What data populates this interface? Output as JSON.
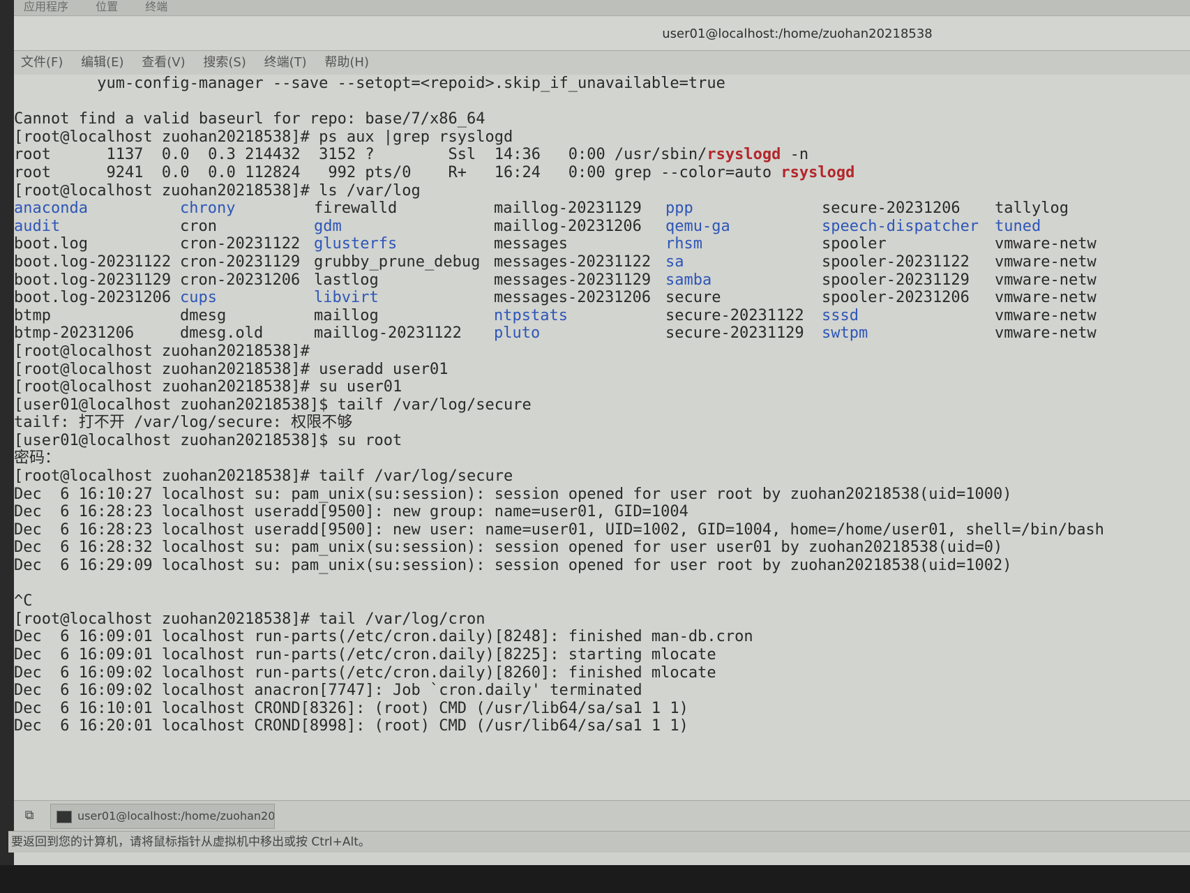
{
  "topbar": {
    "applications": "应用程序",
    "places": "位置",
    "terminal": "终端"
  },
  "window": {
    "title": "user01@localhost:/home/zuohan20218538"
  },
  "menu": [
    "文件(F)",
    "编辑(E)",
    "查看(V)",
    "搜索(S)",
    "终端(T)",
    "帮助(H)"
  ],
  "terminal": {
    "lines_before": [
      "         yum-config-manager --save --setopt=<repoid>.skip_if_unavailable=true",
      "",
      "Cannot find a valid baseurl for repo: base/7/x86_64",
      "[root@localhost zuohan20218538]# ps aux |grep rsyslogd"
    ],
    "ps_rows": [
      {
        "pre": "root      1137  0.0  0.3 214432  3152 ?        Ssl  14:36   0:00 /usr/sbin/",
        "hl": "rsyslogd",
        "post": " -n"
      },
      {
        "pre": "root      9241  0.0  0.0 112824   992 pts/0    R+   16:24   0:00 grep --color=auto ",
        "hl": "rsyslogd",
        "post": ""
      }
    ],
    "ls_command": "[root@localhost zuohan20218538]# ls /var/log",
    "ls_rows": [
      [
        {
          "t": "anaconda",
          "d": true
        },
        {
          "t": "chrony",
          "d": true
        },
        {
          "t": "firewalld",
          "d": false
        },
        {
          "t": "maillog-20231129",
          "d": false
        },
        {
          "t": "ppp",
          "d": true
        },
        {
          "t": "secure-20231206",
          "d": false
        },
        {
          "t": "tallylog",
          "d": false
        }
      ],
      [
        {
          "t": "audit",
          "d": true
        },
        {
          "t": "cron",
          "d": false
        },
        {
          "t": "gdm",
          "d": true
        },
        {
          "t": "maillog-20231206",
          "d": false
        },
        {
          "t": "qemu-ga",
          "d": true
        },
        {
          "t": "speech-dispatcher",
          "d": true
        },
        {
          "t": "tuned",
          "d": true
        }
      ],
      [
        {
          "t": "boot.log",
          "d": false
        },
        {
          "t": "cron-20231122",
          "d": false
        },
        {
          "t": "glusterfs",
          "d": true
        },
        {
          "t": "messages",
          "d": false
        },
        {
          "t": "rhsm",
          "d": true
        },
        {
          "t": "spooler",
          "d": false
        },
        {
          "t": "vmware-netw",
          "d": false
        }
      ],
      [
        {
          "t": "boot.log-20231122",
          "d": false
        },
        {
          "t": "cron-20231129",
          "d": false
        },
        {
          "t": "grubby_prune_debug",
          "d": false
        },
        {
          "t": "messages-20231122",
          "d": false
        },
        {
          "t": "sa",
          "d": true
        },
        {
          "t": "spooler-20231122",
          "d": false
        },
        {
          "t": "vmware-netw",
          "d": false
        }
      ],
      [
        {
          "t": "boot.log-20231129",
          "d": false
        },
        {
          "t": "cron-20231206",
          "d": false
        },
        {
          "t": "lastlog",
          "d": false
        },
        {
          "t": "messages-20231129",
          "d": false
        },
        {
          "t": "samba",
          "d": true
        },
        {
          "t": "spooler-20231129",
          "d": false
        },
        {
          "t": "vmware-netw",
          "d": false
        }
      ],
      [
        {
          "t": "boot.log-20231206",
          "d": false
        },
        {
          "t": "cups",
          "d": true
        },
        {
          "t": "libvirt",
          "d": true
        },
        {
          "t": "messages-20231206",
          "d": false
        },
        {
          "t": "secure",
          "d": false
        },
        {
          "t": "spooler-20231206",
          "d": false
        },
        {
          "t": "vmware-netw",
          "d": false
        }
      ],
      [
        {
          "t": "btmp",
          "d": false
        },
        {
          "t": "dmesg",
          "d": false
        },
        {
          "t": "maillog",
          "d": false
        },
        {
          "t": "ntpstats",
          "d": true
        },
        {
          "t": "secure-20231122",
          "d": false
        },
        {
          "t": "sssd",
          "d": true
        },
        {
          "t": "vmware-netw",
          "d": false
        }
      ],
      [
        {
          "t": "btmp-20231206",
          "d": false
        },
        {
          "t": "dmesg.old",
          "d": false
        },
        {
          "t": "maillog-20231122",
          "d": false
        },
        {
          "t": "pluto",
          "d": true
        },
        {
          "t": "secure-20231129",
          "d": false
        },
        {
          "t": "swtpm",
          "d": true
        },
        {
          "t": "vmware-netw",
          "d": false
        }
      ]
    ],
    "lines_after": [
      "[root@localhost zuohan20218538]#",
      "[root@localhost zuohan20218538]# useradd user01",
      "[root@localhost zuohan20218538]# su user01",
      "[user01@localhost zuohan20218538]$ tailf /var/log/secure",
      "tailf: 打不开 /var/log/secure: 权限不够",
      "[user01@localhost zuohan20218538]$ su root",
      "密码：",
      "[root@localhost zuohan20218538]# tailf /var/log/secure",
      "Dec  6 16:10:27 localhost su: pam_unix(su:session): session opened for user root by zuohan20218538(uid=1000)",
      "Dec  6 16:28:23 localhost useradd[9500]: new group: name=user01, GID=1004",
      "Dec  6 16:28:23 localhost useradd[9500]: new user: name=user01, UID=1002, GID=1004, home=/home/user01, shell=/bin/bash",
      "Dec  6 16:28:32 localhost su: pam_unix(su:session): session opened for user user01 by zuohan20218538(uid=0)",
      "Dec  6 16:29:09 localhost su: pam_unix(su:session): session opened for user root by zuohan20218538(uid=1002)",
      "",
      "^C",
      "[root@localhost zuohan20218538]# tail /var/log/cron",
      "Dec  6 16:09:01 localhost run-parts(/etc/cron.daily)[8248]: finished man-db.cron",
      "Dec  6 16:09:01 localhost run-parts(/etc/cron.daily)[8225]: starting mlocate",
      "Dec  6 16:09:02 localhost run-parts(/etc/cron.daily)[8260]: finished mlocate",
      "Dec  6 16:09:02 localhost anacron[7747]: Job `cron.daily' terminated",
      "Dec  6 16:10:01 localhost CROND[8326]: (root) CMD (/usr/lib64/sa/sa1 1 1)",
      "Dec  6 16:20:01 localhost CROND[8998]: (root) CMD (/usr/lib64/sa/sa1 1 1)"
    ]
  },
  "taskbar": {
    "item_label": "user01@localhost:/home/zuohan20…"
  },
  "statusbar": {
    "text": "要返回到您的计算机，请将鼠标指针从虚拟机中移出或按 Ctrl+Alt。"
  },
  "colors": {
    "directory": "#2e56b8",
    "highlight": "#b3262b",
    "background": "#d2d4cf"
  },
  "icons": {
    "show_desktop": "window-restore-icon",
    "task_item": "terminal-icon"
  }
}
